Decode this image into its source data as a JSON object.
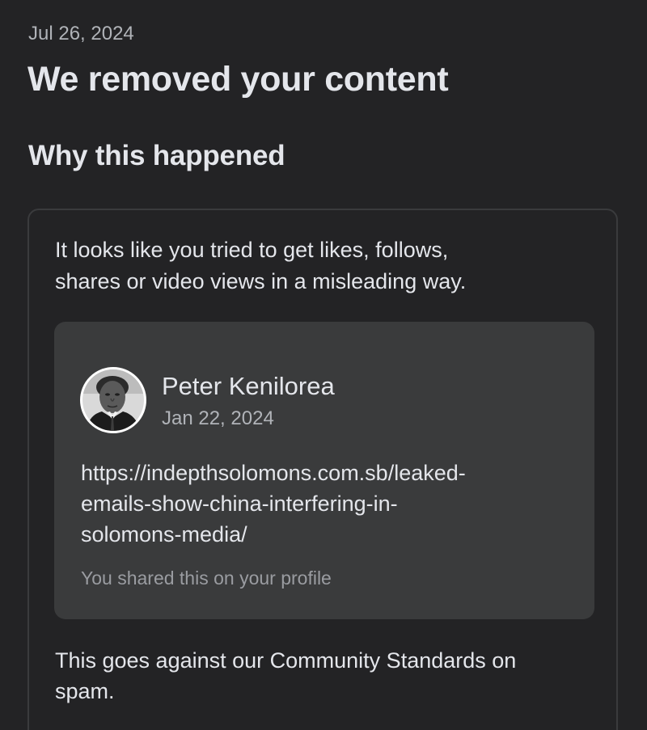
{
  "notice": {
    "date": "Jul 26, 2024",
    "title": "We removed your content",
    "section_heading": "Why this happened"
  },
  "reason": {
    "text_line1": "It looks like you tried to get likes, follows,",
    "text_line2": "shares or video views in a misleading way."
  },
  "post": {
    "author": "Peter Kenilorea",
    "date": "Jan 22, 2024",
    "link_line1": "https://indepthsolomons.com.sb/leaked-",
    "link_line2": "emails-show-china-interfering-in-",
    "link_line3": "solomons-media/",
    "shared_note": "You shared this on your profile",
    "avatar_icon": "profile-photo"
  },
  "policy": {
    "text_line1": "This goes against our Community Standards on",
    "text_line2": "spam."
  },
  "colors": {
    "background": "#232325",
    "card_border": "#3a3b3d",
    "post_card_bg": "#3a3b3c",
    "primary_text": "#e4e6eb",
    "secondary_text": "#b0b3b8"
  }
}
